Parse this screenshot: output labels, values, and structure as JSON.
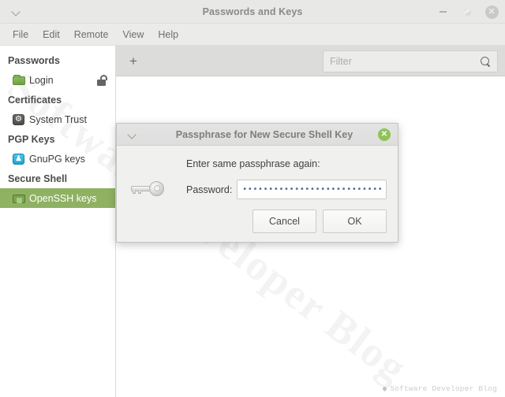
{
  "window": {
    "title": "Passwords and Keys",
    "menu_toggle_icon": "chevron-down-icon",
    "controls": {
      "minimize": "–",
      "maximize": "○",
      "close": "✕"
    }
  },
  "menubar": {
    "items": [
      {
        "label": "File"
      },
      {
        "label": "Edit"
      },
      {
        "label": "Remote"
      },
      {
        "label": "View"
      },
      {
        "label": "Help"
      }
    ]
  },
  "sidebar": {
    "groups": [
      {
        "title": "Passwords",
        "items": [
          {
            "label": "Login",
            "icon": "folder-icon",
            "selected": false,
            "trailing_icon": "unlocked-padlock-icon"
          }
        ]
      },
      {
        "title": "Certificates",
        "items": [
          {
            "label": "System Trust",
            "icon": "gear-icon",
            "selected": false
          }
        ]
      },
      {
        "title": "PGP Keys",
        "items": [
          {
            "label": "GnuPG keys",
            "icon": "gnupg-icon",
            "selected": false
          }
        ]
      },
      {
        "title": "Secure Shell",
        "items": [
          {
            "label": "OpenSSH keys",
            "icon": "folder-open-icon",
            "selected": true
          }
        ]
      }
    ]
  },
  "toolbar": {
    "add_label": "+",
    "add_icon": "plus-icon",
    "filter": {
      "placeholder": "Filter",
      "value": "",
      "icon": "search-icon"
    }
  },
  "dialog": {
    "title": "Passphrase for New Secure Shell Key",
    "header_icon": "chevron-down-icon",
    "close_icon": "close-icon",
    "key_icon": "key-icon",
    "prompt": "Enter same passphrase again:",
    "password_label": "Password:",
    "password_masked": "•••••••••••••••••••••••••••••••",
    "password_value": "",
    "cancel_label": "Cancel",
    "ok_label": "OK"
  },
  "watermarks": {
    "diagonal": "Software Developer Blog",
    "footer": "Software Developer Blog",
    "footer_icon": "leaf-bullet-icon"
  },
  "colors": {
    "accent_green": "#8fb162",
    "dialog_close_green": "#8fc355",
    "titlebar_bg": "#e8e8e7",
    "toolbar_bg": "#dcdcdb",
    "password_dot": "#4a6f9a"
  }
}
